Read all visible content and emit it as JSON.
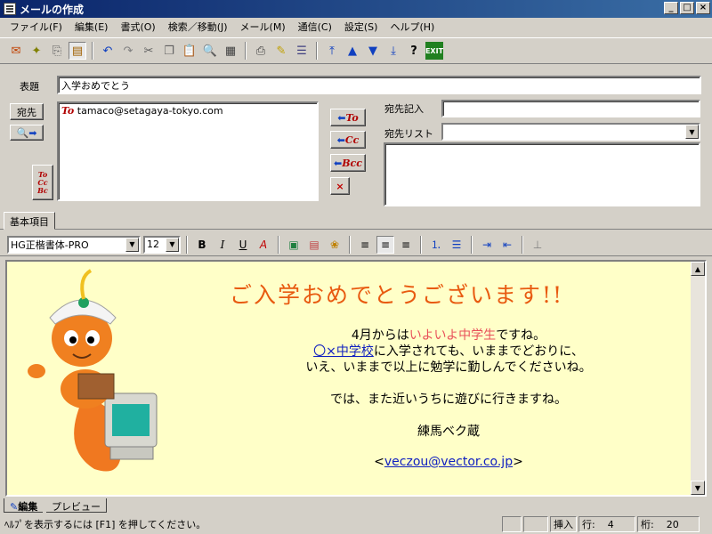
{
  "window": {
    "title": "メールの作成"
  },
  "menu": [
    "ファイル(F)",
    "編集(E)",
    "書式(O)",
    "検索／移動(J)",
    "メール(M)",
    "通信(C)",
    "設定(S)",
    "ヘルプ(H)"
  ],
  "header": {
    "subject_label": "表題",
    "subject_value": "入学おめでとう",
    "address_button": "宛先",
    "recipient_to_mark": "To",
    "recipient_email": "tamaco@setagaya-tokyo.com",
    "to_button": "To",
    "cc_button": "Cc",
    "bcc_button": "Bcc",
    "delete_button": "×",
    "address_entry_label": "宛先記入",
    "address_list_label": "宛先リスト",
    "address_entry_value": "",
    "address_list_value": ""
  },
  "tabs": {
    "basic": "基本項目"
  },
  "format": {
    "font": "HG正楷書体-PRO",
    "size": "12"
  },
  "body": {
    "headline": "ご入学おめでとうございます!!",
    "line1_pre": "4月からは",
    "line1_highlight": "いよいよ中学生",
    "line1_post": "ですね。",
    "line2_link": "〇×中学校",
    "line2_post": "に入学されても、いままでどおりに、",
    "line3": "いえ、いままで以上に勉学に勤しんでくださいね。",
    "line4": "では、また近いうちに遊びに行きますね。",
    "signature": "練馬ベク蔵",
    "email_open": "<",
    "email": "veczou@vector.co.jp",
    "email_close": ">"
  },
  "mode_tabs": {
    "edit": "編集",
    "preview": "プレビュー"
  },
  "status": {
    "help_text": "ﾍﾙﾌﾟを表示するには [F1] を押してください。",
    "insert": "挿入",
    "row_label": "行:",
    "row": "4",
    "col_label": "桁:",
    "col": "20"
  },
  "colors": {
    "headline": "#e85a10",
    "highlight": "#e8505a",
    "link": "#1020c0",
    "editor_bg": "#ffffc8"
  }
}
